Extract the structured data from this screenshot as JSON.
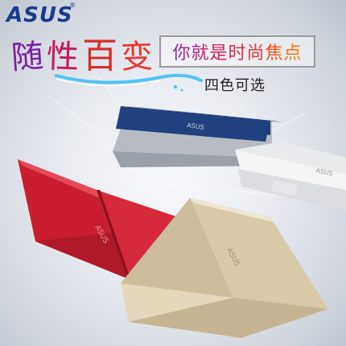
{
  "brand": {
    "name": "ASUS",
    "reg_mark": "®"
  },
  "headline": {
    "chars": [
      "随",
      "性",
      "百",
      "变"
    ]
  },
  "slogan": "你就是时尚焦点",
  "subtitle": "四色可选",
  "laptops": [
    {
      "color_name": "blue",
      "hex": "#1f3a78",
      "lid_logo": "ASUS"
    },
    {
      "color_name": "white",
      "hex": "#f4f4f4",
      "lid_logo": "ASUS"
    },
    {
      "color_name": "red",
      "hex": "#c81e2e",
      "lid_logo": "ASUS"
    },
    {
      "color_name": "gold",
      "hex": "#d8c9a8",
      "lid_logo": "ASUS"
    }
  ]
}
